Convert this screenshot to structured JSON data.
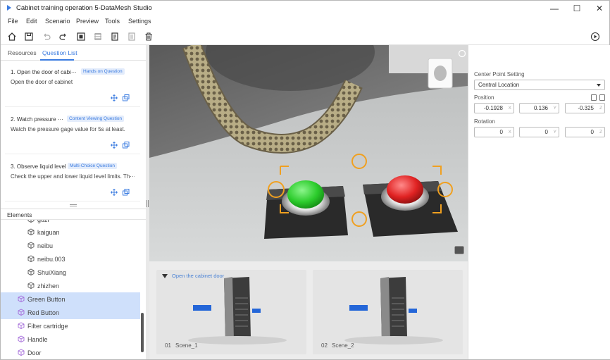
{
  "app": {
    "title": "Cabinet training operation 5-DataMesh Studio"
  },
  "window_controls": {
    "minimize": "—",
    "maximize": "☐",
    "close": "✕"
  },
  "menu": [
    "File",
    "Edit",
    "Scenario",
    "Preview",
    "Tools",
    "Settings"
  ],
  "toolbar_icons": [
    "home-icon",
    "save-icon",
    "undo-icon",
    "redo-icon",
    "screenshot-icon",
    "layers-icon",
    "document-icon",
    "list-icon",
    "trash-icon"
  ],
  "left_tabs": [
    "Resources",
    "Question List"
  ],
  "questions": [
    {
      "title": "1. Open the door of cabi···",
      "tag": "Hands on Question",
      "desc": "Open the door of cabinet"
    },
    {
      "title": "2. Watch pressure ···",
      "tag": "Content Viewing Question",
      "desc": "Watch the pressure gage value for 5s at least."
    },
    {
      "title": "3. Observe liquid level",
      "tag": "Multi-Choice Question",
      "desc": "Check the upper and lower liquid level limits. Th···"
    }
  ],
  "elements_header": "Elements",
  "elements": [
    {
      "label": "guzi",
      "indent": 2,
      "selected": false
    },
    {
      "label": "kaiguan",
      "indent": 2,
      "selected": false
    },
    {
      "label": "neibu",
      "indent": 2,
      "selected": false
    },
    {
      "label": "neibu.003",
      "indent": 2,
      "selected": false
    },
    {
      "label": "ShuiXiang",
      "indent": 2,
      "selected": false
    },
    {
      "label": "zhizhen",
      "indent": 2,
      "selected": false
    },
    {
      "label": "Green Button",
      "indent": 1,
      "selected": true
    },
    {
      "label": "Red Button",
      "indent": 1,
      "selected": true
    },
    {
      "label": "Filter cartridge",
      "indent": 1,
      "selected": false
    },
    {
      "label": "Handle",
      "indent": 1,
      "selected": false
    },
    {
      "label": "Door",
      "indent": 1,
      "selected": false
    }
  ],
  "scenes": [
    {
      "title": "Open the cabinet door",
      "num": "01",
      "name": "Scene_1"
    },
    {
      "num": "02",
      "name": "Scene_2"
    }
  ],
  "properties": {
    "center_label": "Center Point Setting",
    "center_value": "Central Location",
    "position_label": "Position",
    "position": {
      "x": "-0.1928",
      "y": "0.136",
      "z": "-0.325"
    },
    "rotation_label": "Rotation",
    "rotation": {
      "x": "0",
      "y": "0",
      "z": "0"
    },
    "axis_x": "X",
    "axis_y": "Y",
    "axis_z": "Z"
  },
  "colors": {
    "accent": "#3a7be0",
    "selected_row": "#cfe0fb",
    "element_icon": "#a36ad9",
    "green_button": "#2ccc2c",
    "red_button": "#e02222",
    "orange_marker": "#f0a020"
  }
}
